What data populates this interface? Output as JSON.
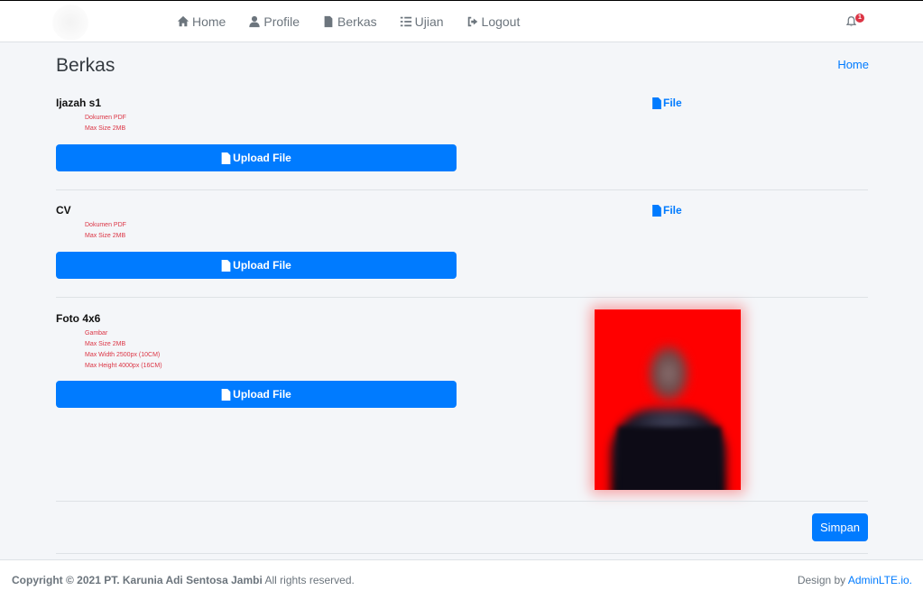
{
  "nav": {
    "items": [
      {
        "label": "Home",
        "icon": "home-icon"
      },
      {
        "label": "Profile",
        "icon": "user-icon"
      },
      {
        "label": "Berkas",
        "icon": "file-icon"
      },
      {
        "label": "Ujian",
        "icon": "list-icon"
      },
      {
        "label": "Logout",
        "icon": "logout-icon"
      }
    ],
    "notifications": {
      "icon": "bell-icon",
      "count": "1"
    }
  },
  "page": {
    "title": "Berkas",
    "breadcrumb": "Home"
  },
  "sections": [
    {
      "title": "Ijazah s1",
      "requirements": [
        "Dokumen PDF",
        "Max Size 2MB"
      ],
      "upload_label": "Upload File",
      "file_label": "File"
    },
    {
      "title": "CV",
      "requirements": [
        "Dokumen PDF",
        "Max Size 2MB"
      ],
      "upload_label": "Upload File",
      "file_label": "File"
    },
    {
      "title": "Foto 4x6",
      "requirements": [
        "Gambar",
        "Max Size 2MB",
        "Max Width 2500px (10CM)",
        "Max Height 4000px (16CM)"
      ],
      "upload_label": "Upload File"
    }
  ],
  "save_label": "Simpan",
  "footer": {
    "copyright": "Copyright © 2021 PT. Karunia Adi Sentosa Jambi",
    "rights": " All rights reserved.",
    "design_prefix": "Design by ",
    "design_link": "AdminLTE.io."
  },
  "colors": {
    "primary": "#007bff",
    "danger": "#dc3545",
    "photo_background": "#ff0000"
  }
}
